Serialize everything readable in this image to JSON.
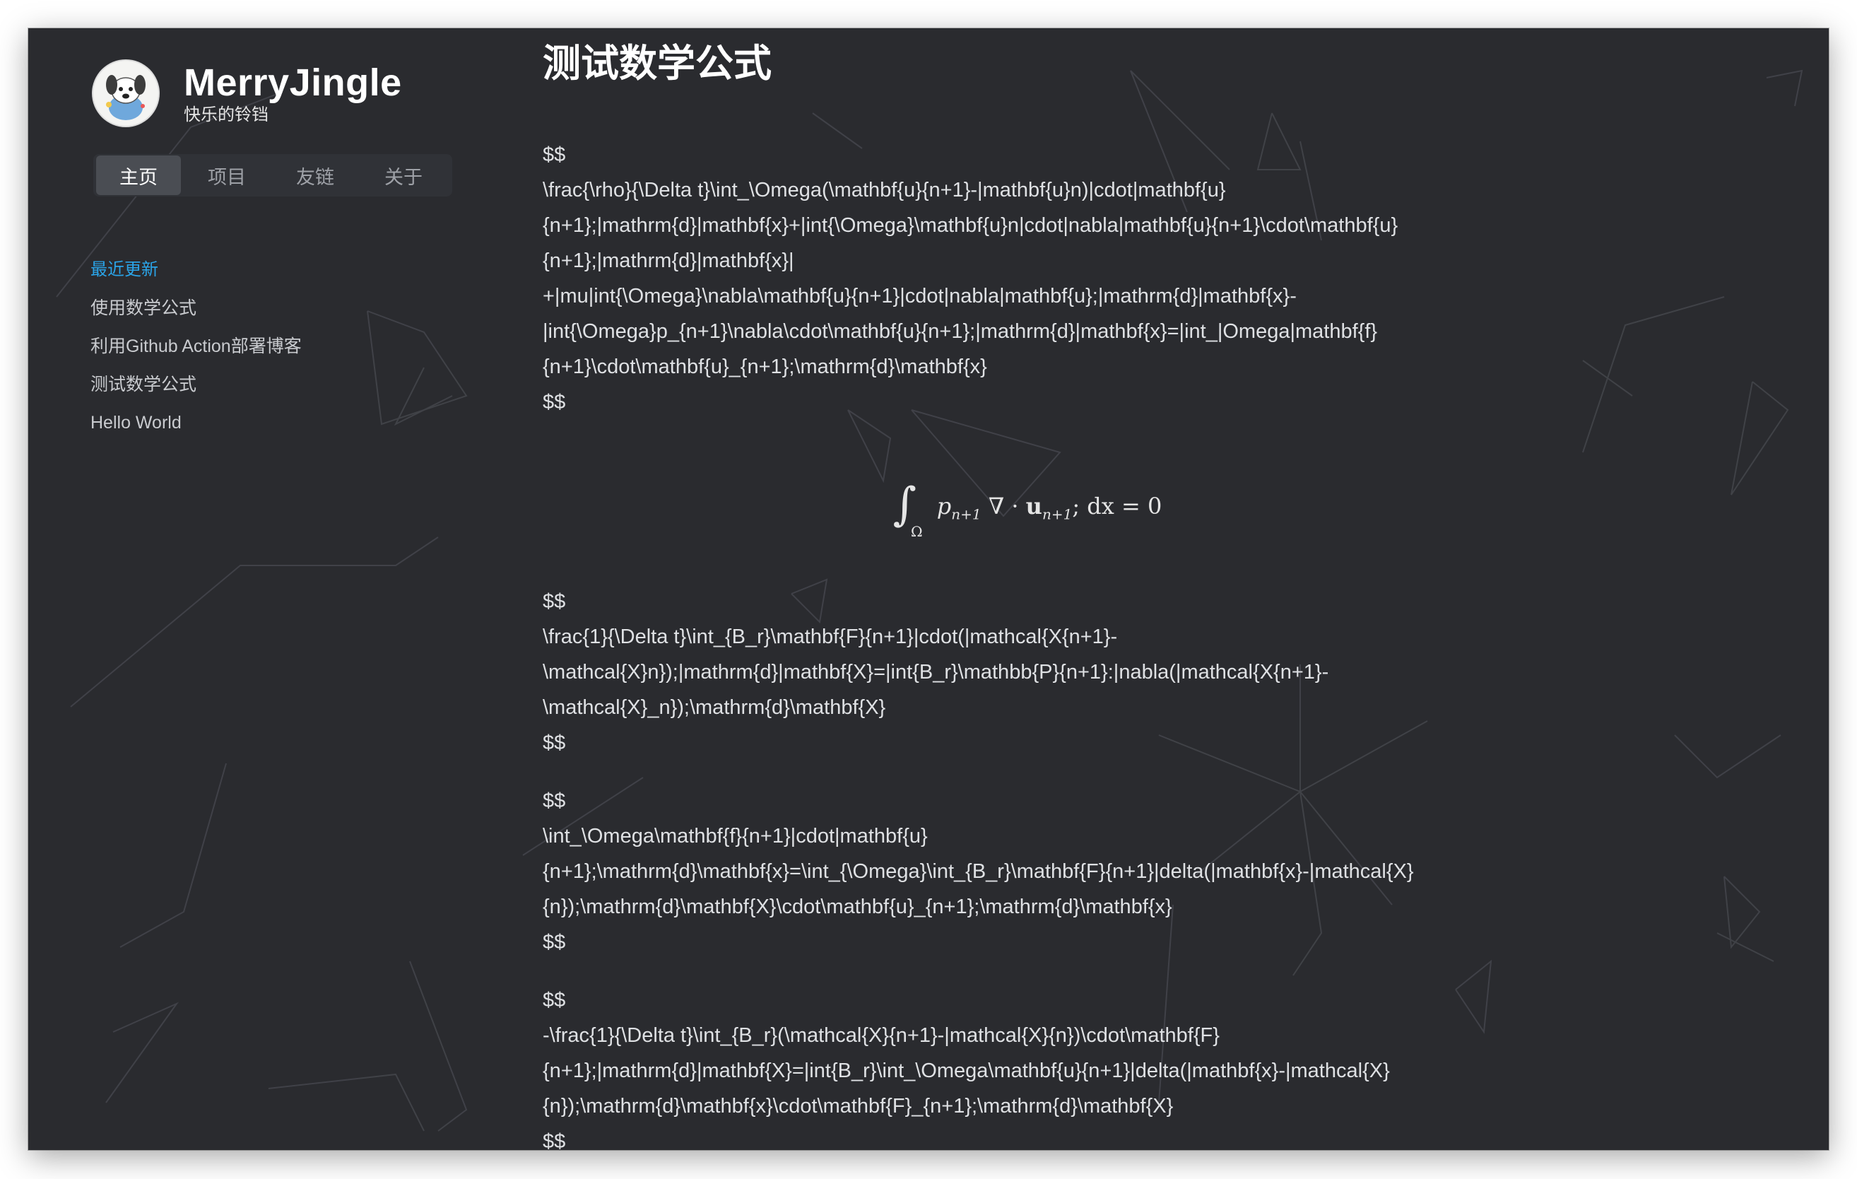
{
  "site": {
    "title": "MerryJingle",
    "subtitle": "快乐的铃铛"
  },
  "nav": {
    "items": [
      {
        "label": "主页",
        "active": true
      },
      {
        "label": "项目",
        "active": false
      },
      {
        "label": "友链",
        "active": false
      },
      {
        "label": "关于",
        "active": false
      }
    ]
  },
  "recent": {
    "title": "最近更新",
    "items": [
      "使用数学公式",
      "利用Github Action部署博客",
      "测试数学公式",
      "Hello World"
    ]
  },
  "post": {
    "title": "测试数学公式",
    "blocks": [
      {
        "lines": [
          "$$",
          "\\frac{\\rho}{\\Delta t}\\int_\\Omega(\\mathbf{u}{n+1}-|mathbf{u}n)|cdot|mathbf{u}",
          "{n+1};|mathrm{d}|mathbf{x}+|int{\\Omega}\\mathbf{u}n|cdot|nabla|mathbf{u}{n+1}\\cdot\\mathbf{u}",
          "{n+1};|mathrm{d}|mathbf{x}|",
          "+|mu|int{\\Omega}\\nabla\\mathbf{u}{n+1}|cdot|nabla|mathbf{u};|mathrm{d}|mathbf{x}-",
          "|int{\\Omega}p_{n+1}\\nabla\\cdot\\mathbf{u}{n+1};|mathrm{d}|mathbf{x}=|int_|Omega|mathbf{f}",
          "{n+1}\\cdot\\mathbf{u}_{n+1};\\mathrm{d}\\mathbf{x}",
          "$$"
        ]
      },
      {
        "lines": [
          "$$",
          "\\frac{1}{\\Delta t}\\int_{B_r}\\mathbf{F}{n+1}|cdot(|mathcal{X{n+1}-",
          "\\mathcal{X}n});|mathrm{d}|mathbf{X}=|int{B_r}\\mathbb{P}{n+1}:|nabla(|mathcal{X{n+1}-",
          "\\mathcal{X}_n});\\mathrm{d}\\mathbf{X}",
          "$$"
        ]
      },
      {
        "lines": [
          "$$",
          "\\int_\\Omega\\mathbf{f}{n+1}|cdot|mathbf{u}",
          "{n+1};\\mathrm{d}\\mathbf{x}=\\int_{\\Omega}\\int_{B_r}\\mathbf{F}{n+1}|delta(|mathbf{x}-|mathcal{X}",
          "{n});\\mathrm{d}\\mathbf{X}\\cdot\\mathbf{u}_{n+1};\\mathrm{d}\\mathbf{x}",
          "$$"
        ]
      },
      {
        "lines": [
          "$$",
          "-\\frac{1}{\\Delta t}\\int_{B_r}(\\mathcal{X}{n+1}-|mathcal{X}{n})\\cdot\\mathbf{F}",
          "{n+1};|mathrm{d}|mathbf{X}=|int{B_r}\\int_\\Omega\\mathbf{u}{n+1}|delta(|mathbf{x}-|mathcal{X}",
          "{n});\\mathrm{d}\\mathbf{x}\\cdot\\mathbf{F}_{n+1};\\mathrm{d}\\mathbf{X}",
          "$$"
        ]
      }
    ],
    "display_math": {
      "integral": "∫",
      "domain": "Ω",
      "body": "p",
      "sub_p": "n+1",
      "nabla_dot": " ∇ · ",
      "u": "u",
      "sub_u": "n+1",
      "tail": "; dx = 0"
    }
  },
  "colors": {
    "background": "#2a2b2f",
    "accent": "#2aa4e8",
    "nav_bg": "#303237",
    "nav_active": "#4a4d53"
  }
}
